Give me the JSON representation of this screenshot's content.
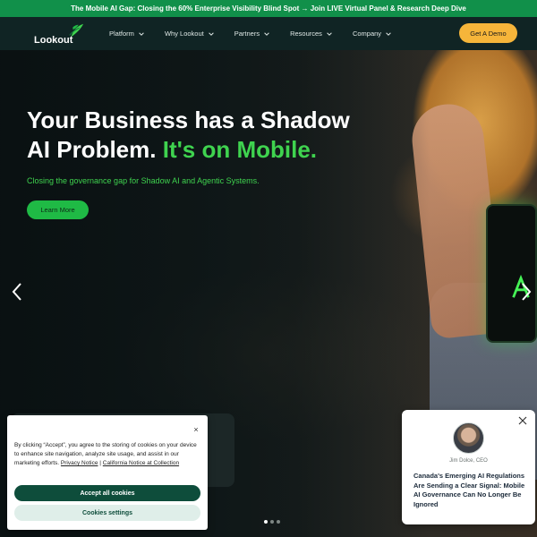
{
  "announcement": {
    "text": "The Mobile AI Gap: Closing the 60% Enterprise Visibility Blind Spot → Join LIVE Virtual Panel & Research Deep Dive"
  },
  "header": {
    "logo_text": "Lookout",
    "menu": [
      {
        "label": "Platform",
        "icon": "chevron-down-icon"
      },
      {
        "label": "Why Lookout",
        "icon": "chevron-down-icon"
      },
      {
        "label": "Partners",
        "icon": "chevron-down-icon"
      },
      {
        "label": "Resources",
        "icon": "chevron-down-icon"
      },
      {
        "label": "Company",
        "icon": "chevron-down-icon"
      }
    ],
    "cta_label": "Get A Demo"
  },
  "hero": {
    "headline_part1": "Your Business has a Shadow AI Problem.",
    "headline_accent": "It's on Mobile.",
    "subheading": "Closing the governance gap for Shadow AI and Agentic Systems.",
    "button_label": "Learn More",
    "slides_total": 3,
    "active_slide": 1
  },
  "cookie_banner": {
    "text": "By clicking “Accept”, you agree to the storing of cookies on your device to enhance site navigation, analyze site usage, and assist in our marketing efforts.",
    "privacy_link": "Privacy Notice",
    "separator": "|",
    "california_link": "California Notice at Collection",
    "accept_label": "Accept all cookies",
    "settings_label": "Cookies settings",
    "close_glyph": "×"
  },
  "promo": {
    "author": "Jim Dolce, CEO",
    "title": "Canada's Emerging AI Regulations Are Sending a Clear Signal: Mobile AI Governance Can No Longer Be Ignored"
  },
  "colors": {
    "brand_green": "#11904a",
    "accent_green": "#3fd34f",
    "cta_yellow": "#f6b53a",
    "nav_bg": "#102424",
    "cookie_primary": "#0e4d3b"
  }
}
